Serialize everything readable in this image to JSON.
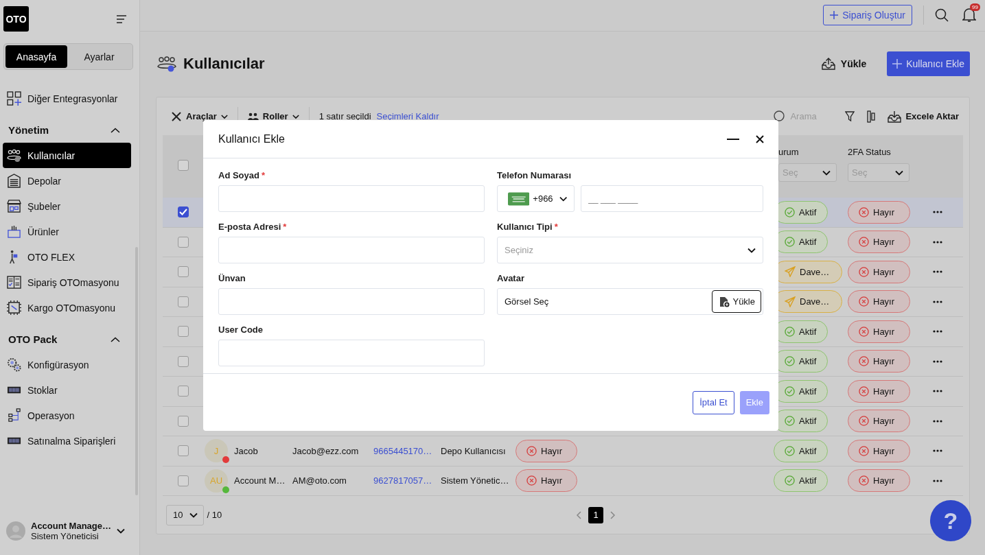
{
  "app": {
    "logo": "OTO"
  },
  "topbar": {
    "create_button": "Sipariş Oluştur",
    "notification_count": "99"
  },
  "sidebar": {
    "tabs": [
      {
        "label": "Anasayfa",
        "selected": true
      },
      {
        "label": "Ayarlar",
        "selected": false
      }
    ],
    "items": [
      {
        "label": "Diğer Entegrasyonlar",
        "selected": false
      }
    ],
    "sections": [
      {
        "title": "Yönetim",
        "expanded": true,
        "items": [
          {
            "label": "Kullanıcılar",
            "selected": true
          },
          {
            "label": "Depolar",
            "selected": false
          },
          {
            "label": "Şubeler",
            "selected": false
          },
          {
            "label": "Ürünler",
            "selected": false
          },
          {
            "label": "OTO FLEX",
            "selected": false
          },
          {
            "label": "Sipariş OTOmasyonu",
            "selected": false
          },
          {
            "label": "Kargo OTOmasyonu",
            "selected": false
          }
        ]
      },
      {
        "title": "OTO Pack",
        "expanded": true,
        "items": [
          {
            "label": "Konfigürasyon",
            "selected": false
          },
          {
            "label": "Stoklar",
            "selected": false
          },
          {
            "label": "Operasyon",
            "selected": false
          },
          {
            "label": "Satınalma Siparişleri",
            "selected": false
          }
        ]
      }
    ],
    "user": {
      "name": "Account Manage…",
      "role": "Sistem Yöneticisi"
    }
  },
  "page": {
    "title": "Kullanıcılar",
    "upload_button": "Yükle",
    "add_button": "Kullanıcı Ekle"
  },
  "toolbar": {
    "tools": "Araçlar",
    "roles": "Roller",
    "selection": "1 satır seçildi",
    "clear_link": "Seçimleri Kaldır",
    "search_placeholder": "Arama",
    "export": "Excele Aktar"
  },
  "table": {
    "header_checked": false,
    "columns": [
      {
        "title": "urum",
        "filter": "Seç"
      },
      {
        "title": "2FA Status",
        "filter": "Seç"
      }
    ],
    "rows": [
      {
        "selected": true,
        "status": {
          "kind": "active",
          "label": "Aktif"
        },
        "twofa": "Hayır"
      },
      {
        "selected": false,
        "status": {
          "kind": "active",
          "label": "Aktif"
        },
        "twofa": "Hayır"
      },
      {
        "selected": false,
        "status": {
          "kind": "invited",
          "label": "Dave…"
        },
        "twofa": "Hayır"
      },
      {
        "selected": false,
        "status": {
          "kind": "invited",
          "label": "Dave…"
        },
        "twofa": "Hayır"
      },
      {
        "selected": false,
        "status": {
          "kind": "active",
          "label": "Aktif"
        },
        "twofa": "Hayır"
      },
      {
        "selected": false,
        "status": {
          "kind": "active",
          "label": "Aktif"
        },
        "twofa": "Hayır"
      },
      {
        "selected": false,
        "status": {
          "kind": "active",
          "label": "Aktif"
        },
        "twofa": "Hayır"
      },
      {
        "selected": false,
        "status": {
          "kind": "active",
          "label": "Aktif"
        },
        "twofa": "Hayır"
      },
      {
        "selected": false,
        "avatar": {
          "initials": "J",
          "color": "#e23b3b"
        },
        "name": "Jacob",
        "email": "Jacob@ezz.com",
        "phone": "9665445170…",
        "role": "Depo Kullanıcısı",
        "column_6": "Hayır",
        "status": {
          "kind": "active",
          "label": "Aktif"
        },
        "twofa": "Hayır"
      },
      {
        "selected": false,
        "avatar": {
          "initials": "AU",
          "color": "#56b83c"
        },
        "name": "Account M…",
        "email": "AM@oto.com",
        "phone": "9627817057…",
        "role": "Sistem Yönetic…",
        "column_6": "Hayır",
        "status": {
          "kind": "active",
          "label": "Aktif"
        },
        "twofa": "Hayır"
      }
    ]
  },
  "pagination": {
    "page_size": "10",
    "total": "/ 10",
    "pages": [
      {
        "label": "1",
        "selected": true
      }
    ]
  },
  "modal": {
    "title": "Kullanıcı Ekle",
    "fields": [
      {
        "kind": "text",
        "label": "Ad Soyad",
        "required_mark": "*"
      },
      {
        "kind": "phone",
        "label": "Telefon Numarası",
        "country_code": "+966",
        "placeholder": "__ ___ ____"
      },
      {
        "kind": "text",
        "label": "E-posta Adresi",
        "required_mark": "*"
      },
      {
        "kind": "select",
        "label": "Kullanıcı Tipi",
        "required_mark": "*",
        "placeholder": "Seçiniz"
      },
      {
        "kind": "text",
        "label": "Ünvan"
      },
      {
        "kind": "file",
        "label": "Avatar",
        "value": "Görsel Seç",
        "button": "Yükle"
      },
      {
        "kind": "text",
        "label": "User Code"
      }
    ],
    "buttons": [
      {
        "label": "İptal Et",
        "kind": "secondary",
        "disabled": false
      },
      {
        "label": "Ekle",
        "kind": "primary",
        "disabled": true
      }
    ]
  },
  "help_button": "?"
}
